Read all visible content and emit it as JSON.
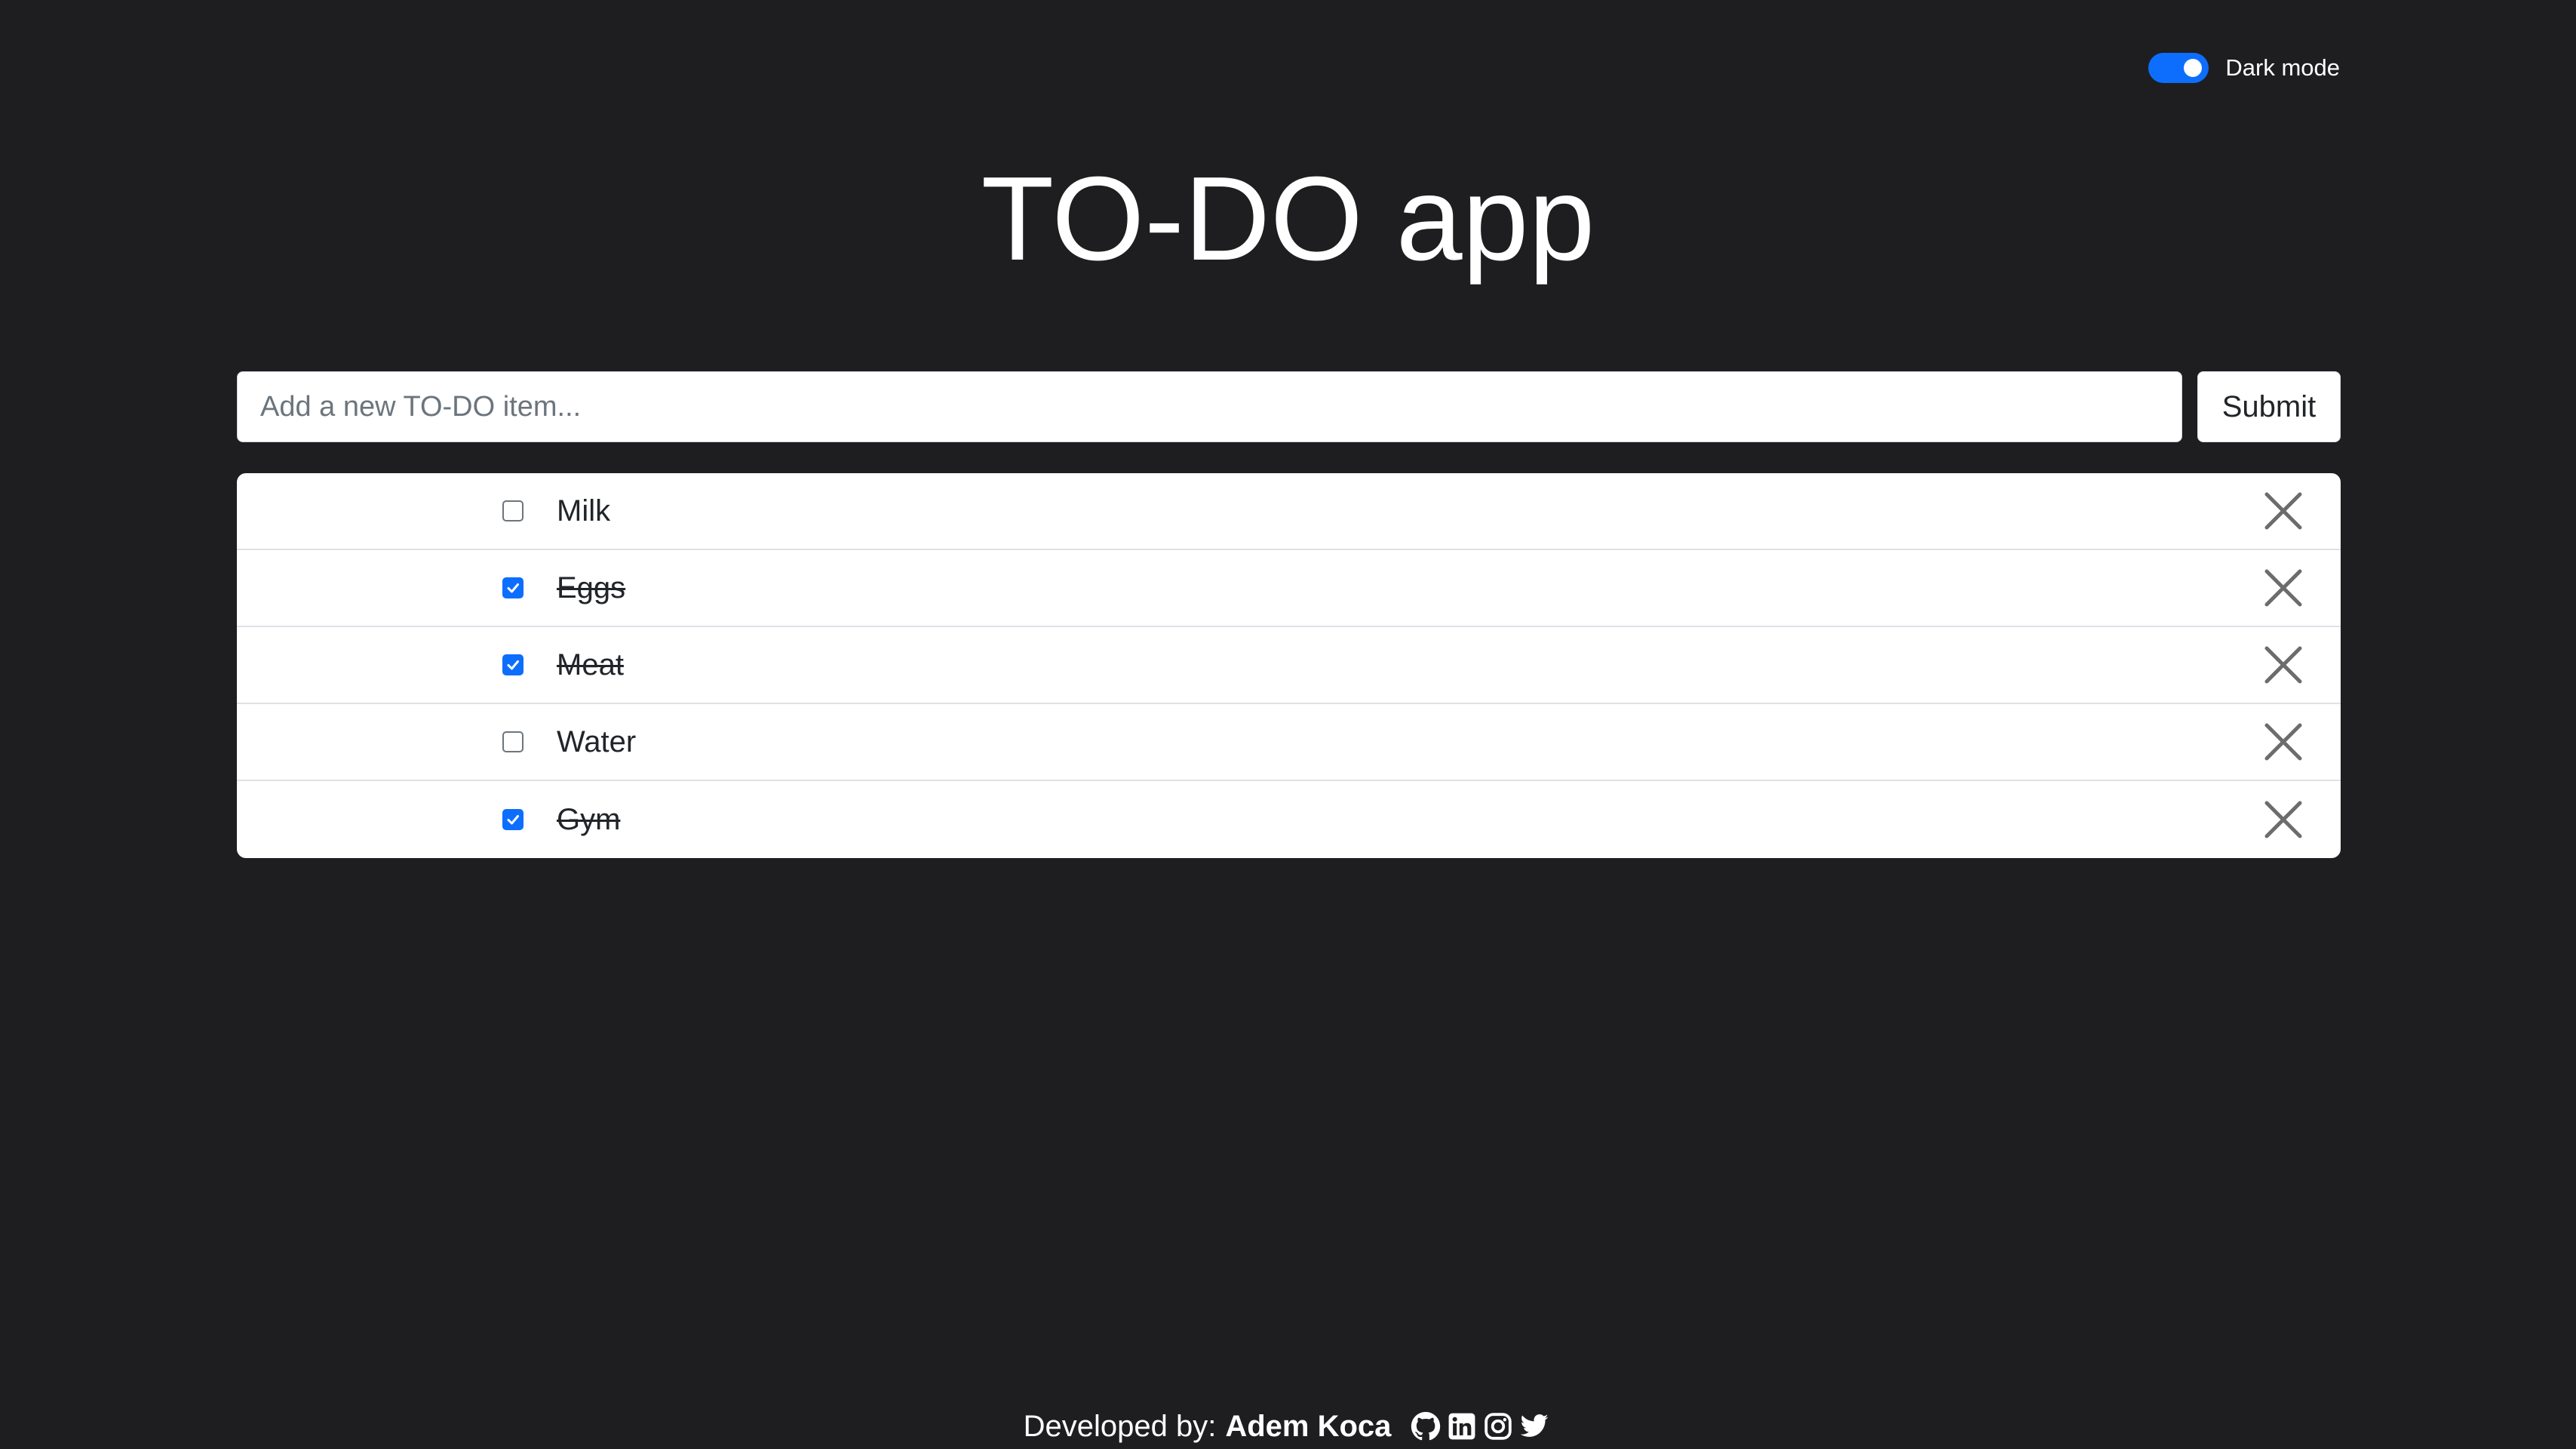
{
  "dark_mode": {
    "label": "Dark mode",
    "enabled": true,
    "accent_color": "#0d6efd"
  },
  "header": {
    "title": "TO-DO app"
  },
  "input": {
    "placeholder": "Add a new TO-DO item...",
    "value": "",
    "submit_label": "Submit"
  },
  "todos": {
    "items": [
      {
        "label": "Milk",
        "done": false
      },
      {
        "label": "Eggs",
        "done": true
      },
      {
        "label": "Meat",
        "done": true
      },
      {
        "label": "Water",
        "done": false
      },
      {
        "label": "Gym",
        "done": true
      }
    ]
  },
  "footer": {
    "prefix": "Developed by:",
    "author": "Adem Koca",
    "social_icons": [
      "github-icon",
      "linkedin-icon",
      "instagram-icon",
      "twitter-icon"
    ]
  },
  "colors": {
    "background": "#1e1e20",
    "checkbox_checked": "#0d6efd",
    "text_dark": "#212529"
  }
}
